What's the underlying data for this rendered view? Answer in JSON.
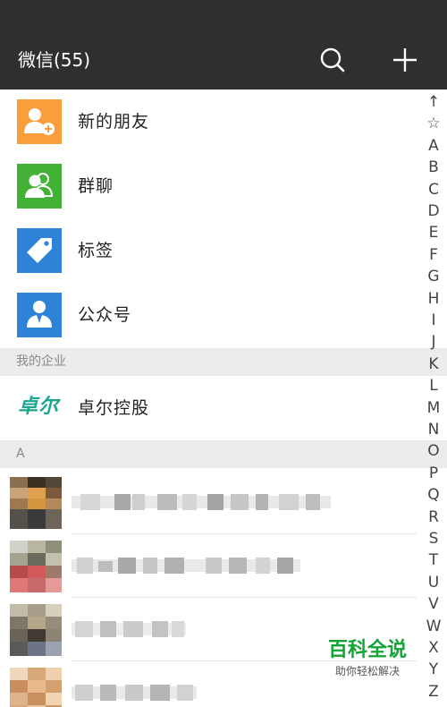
{
  "header": {
    "title": "微信(55)",
    "search_icon": "search-icon",
    "add_icon": "plus-icon",
    "background": "#2f2f2f"
  },
  "menu": [
    {
      "label": "新的朋友",
      "icon": "add-friend-icon",
      "color": "#fa9d3b"
    },
    {
      "label": "群聊",
      "icon": "group-chat-icon",
      "color": "#42b236"
    },
    {
      "label": "标签",
      "icon": "tag-icon",
      "color": "#2e82d7"
    },
    {
      "label": "公众号",
      "icon": "official-account-icon",
      "color": "#2e82d7"
    }
  ],
  "enterprise": {
    "section_label": "我的企业",
    "logo_text": "卓尔",
    "name": "卓尔控股",
    "logo_color": "#1aa68f"
  },
  "contacts": {
    "section_label": "A"
  },
  "index_bar": [
    "↑",
    "☆",
    "A",
    "B",
    "C",
    "D",
    "E",
    "F",
    "G",
    "H",
    "I",
    "J",
    "K",
    "L",
    "M",
    "N",
    "O",
    "P",
    "Q",
    "R",
    "S",
    "T",
    "U",
    "V",
    "W",
    "X",
    "Y",
    "Z"
  ],
  "watermark": {
    "title": "百科全说",
    "subtitle": "助你轻松解决",
    "color": "#12a536"
  }
}
